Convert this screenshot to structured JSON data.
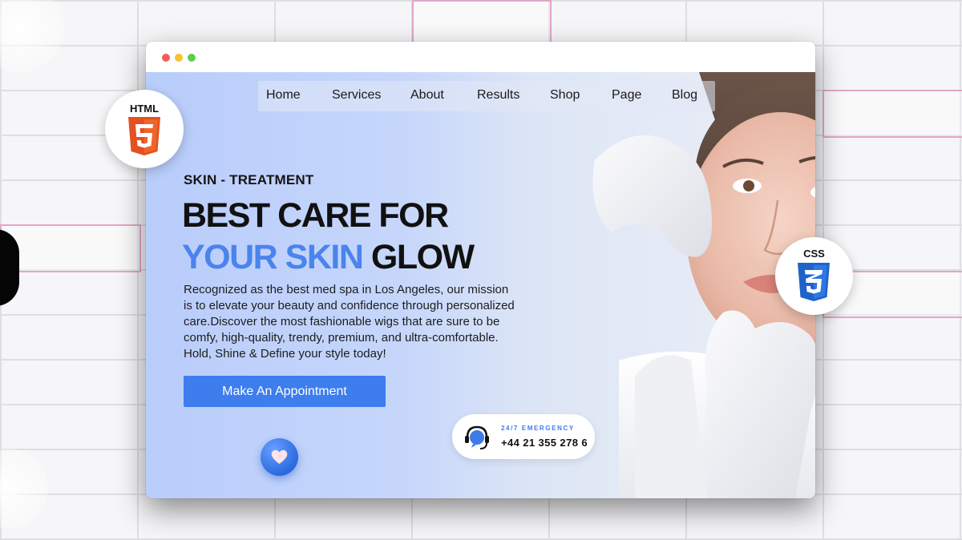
{
  "background": {
    "grid_color": "#dedee3",
    "accent_box_color": "#e3a6c9"
  },
  "window": {
    "controls": [
      "close-dot",
      "minimize-dot",
      "maximize-dot"
    ]
  },
  "nav": {
    "items": [
      "Home",
      "Services",
      "About",
      "Results",
      "Shop",
      "Page",
      "Blog"
    ]
  },
  "hero": {
    "kicker": "SKIN - TREATMENT",
    "headline_line1": "BEST CARE FOR",
    "headline_accent": "YOUR SKIN",
    "headline_rest": " GLOW",
    "description": "Recognized as the best med spa in Los Angeles, our mission is to elevate your beauty and confidence through personalized care.Discover the most fashionable wigs that are sure to be comfy, high-quality, trendy, premium, and ultra-comfortable. Hold, Shine & Define your style today!",
    "cta_label": "Make An Appointment",
    "accent_color": "#4a84ec",
    "button_color": "#3d7ded"
  },
  "emergency": {
    "label": "24/7 EMERGENCY",
    "phone": "+44 21 355 278 6",
    "icon": "headset-chat-icon"
  },
  "badges": {
    "html_label": "HTML",
    "html_icon": "html5-logo-icon",
    "css_label": "CSS",
    "css_icon": "css3-logo-icon"
  },
  "decor": {
    "heart_icon": "heart-bubble-icon"
  }
}
